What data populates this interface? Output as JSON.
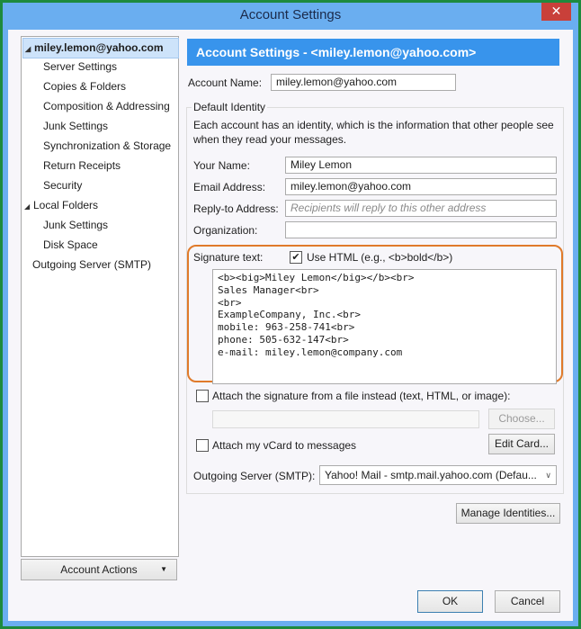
{
  "window": {
    "title": "Account Settings",
    "close_glyph": "✕"
  },
  "sidebar": {
    "items": [
      {
        "label": "miley.lemon@yahoo.com",
        "level": 0,
        "expanded": true,
        "selected": true
      },
      {
        "label": "Server Settings",
        "level": 1
      },
      {
        "label": "Copies & Folders",
        "level": 1
      },
      {
        "label": "Composition & Addressing",
        "level": 1
      },
      {
        "label": "Junk Settings",
        "level": 1
      },
      {
        "label": "Synchronization & Storage",
        "level": 1
      },
      {
        "label": "Return Receipts",
        "level": 1
      },
      {
        "label": "Security",
        "level": 1
      },
      {
        "label": "Local Folders",
        "level": 0,
        "expanded": true
      },
      {
        "label": "Junk Settings",
        "level": 1
      },
      {
        "label": "Disk Space",
        "level": 1
      },
      {
        "label": "Outgoing Server (SMTP)",
        "level": 0
      }
    ],
    "account_actions_label": "Account Actions"
  },
  "main": {
    "header": "Account Settings - <miley.lemon@yahoo.com>",
    "account_name_label": "Account Name:",
    "account_name_value": "miley.lemon@yahoo.com",
    "default_identity": {
      "legend": "Default Identity",
      "description_line1": "Each account has an identity, which is the information that other people see",
      "description_line2": "when they read your messages.",
      "your_name_label": "Your Name:",
      "your_name_value": "Miley Lemon",
      "email_label": "Email Address:",
      "email_value": "miley.lemon@yahoo.com",
      "reply_to_label": "Reply-to Address:",
      "reply_to_placeholder": "Recipients will reply to this other address",
      "organization_label": "Organization:",
      "organization_value": "",
      "signature_label": "Signature text:",
      "use_html_label": "Use HTML (e.g., <b>bold</b>)",
      "use_html_checked": true,
      "signature_text": "<b><big>Miley Lemon</big></b><br>\nSales Manager<br>\n<br>\nExampleCompany, Inc.<br>\nmobile: 963-258-741<br>\nphone: 505-632-147<br>\ne-mail: miley.lemon@company.com",
      "attach_file_label": "Attach the signature from a file instead (text, HTML, or image):",
      "attach_file_checked": false,
      "attach_file_value": "",
      "choose_label": "Choose...",
      "attach_vcard_label": "Attach my vCard to messages",
      "attach_vcard_checked": false,
      "edit_card_label": "Edit Card...",
      "outgoing_server_label": "Outgoing Server (SMTP):",
      "outgoing_server_value": "Yahoo! Mail - smtp.mail.yahoo.com (Defau..."
    },
    "manage_identities_label": "Manage Identities...",
    "ok_label": "OK",
    "cancel_label": "Cancel"
  },
  "colors": {
    "header_bg": "#3894ec",
    "highlight_border": "#e07a2a",
    "selection_bg": "#cde3fa",
    "close_bg": "#c9403a"
  }
}
